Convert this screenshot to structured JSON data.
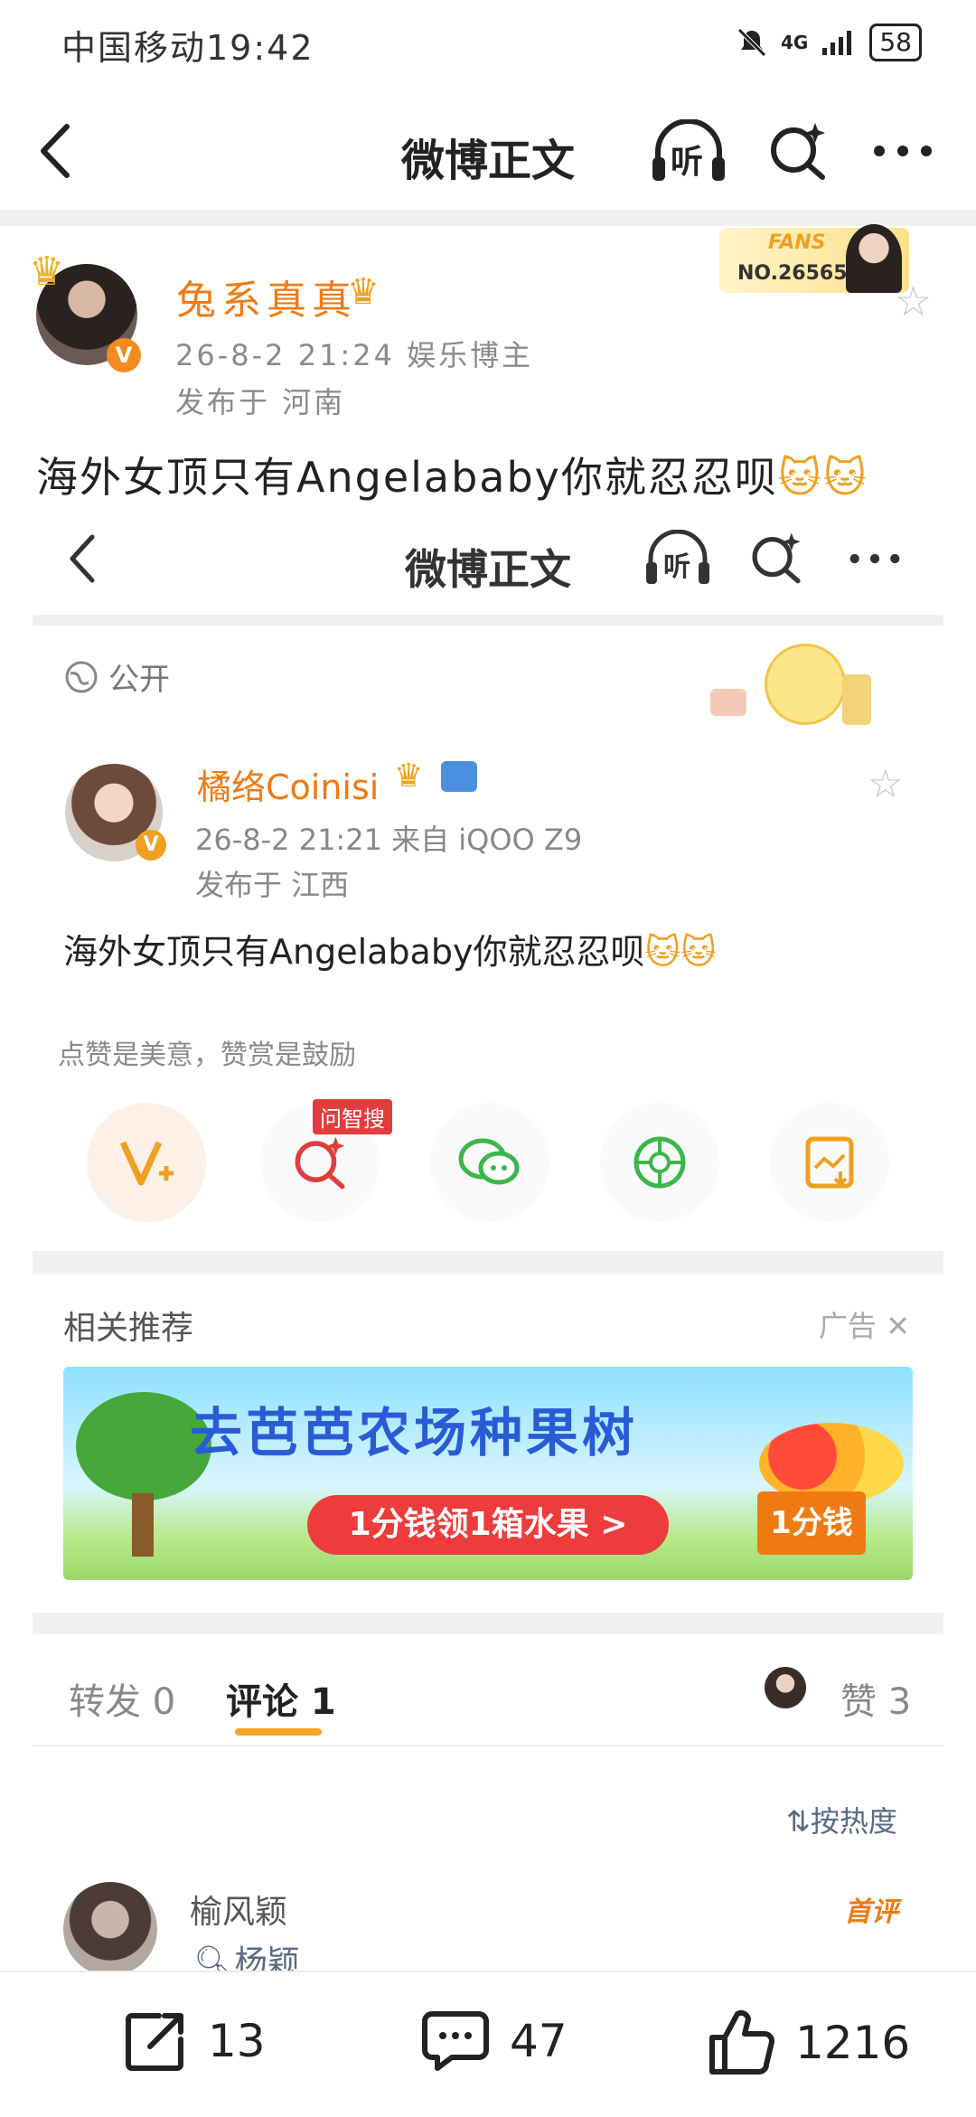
{
  "status": {
    "carrier_time": "中国移动19:42",
    "network": "4G",
    "battery": "58"
  },
  "nav": {
    "title": "微博正文",
    "listen_label": "听"
  },
  "post": {
    "author": "兔系真真",
    "meta_line": "26-8-2 21:24  娱乐博主",
    "location": "发布于 河南",
    "fans_badge_title": "FANS",
    "fans_badge_no": "NO.265657",
    "text": "海外女顶只有Angelababy你就忍忍呗"
  },
  "embedded": {
    "nav_title": "微博正文",
    "listen_label": "听",
    "visibility": "公开",
    "author": "橘络Coinisi",
    "meta_line": "26-8-2 21:21   来自 iQOO Z9",
    "location": "发布于 江西",
    "text": "海外女顶只有Angelababy你就忍忍呗",
    "hint": "点赞是美意，赞赏是鼓励",
    "wenzhi_badge": "问智搜",
    "related_title": "相关推荐",
    "ad_label": "广告",
    "banner_title": "去芭芭农场种果树",
    "banner_cta": "1分钱领1箱水果 >",
    "banner_side": "1分钱",
    "tab_repost": "转发 0",
    "tab_comment": "评论 1",
    "tab_like": "赞 3",
    "sort_label": "按热度",
    "comment_name": "榆风颖",
    "comment_sub": "杨颖",
    "first_comment": "首评"
  },
  "bottom": {
    "repost_count": "13",
    "comment_count": "47",
    "like_count": "1216"
  },
  "colors": {
    "accent_orange": "#f07a12",
    "tab_underline": "#f5a623",
    "banner_red": "#ee3b3b"
  }
}
